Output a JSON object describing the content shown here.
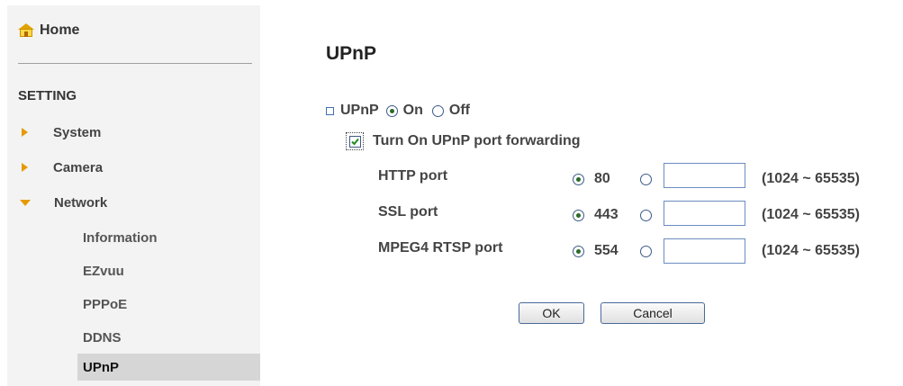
{
  "sidebar": {
    "home_label": "Home",
    "section_label": "SETTING",
    "items": [
      {
        "label": "System"
      },
      {
        "label": "Camera"
      },
      {
        "label": "Network"
      }
    ],
    "network_sub": [
      {
        "label": "Information"
      },
      {
        "label": "EZvuu"
      },
      {
        "label": "PPPoE"
      },
      {
        "label": "DDNS"
      },
      {
        "label": "UPnP"
      }
    ]
  },
  "main": {
    "title": "UPnP",
    "upnp_label": "UPnP",
    "on_label": "On",
    "off_label": "Off",
    "port_forward_label": "Turn On UPnP port forwarding",
    "ports": [
      {
        "label": "HTTP port",
        "default": "80",
        "custom_value": "",
        "range": "(1024 ~ 65535)"
      },
      {
        "label": "SSL port",
        "default": "443",
        "custom_value": "",
        "range": "(1024 ~ 65535)"
      },
      {
        "label": "MPEG4 RTSP port",
        "default": "554",
        "custom_value": "",
        "range": "(1024 ~ 65535)"
      }
    ],
    "ok_label": "OK",
    "cancel_label": "Cancel"
  }
}
